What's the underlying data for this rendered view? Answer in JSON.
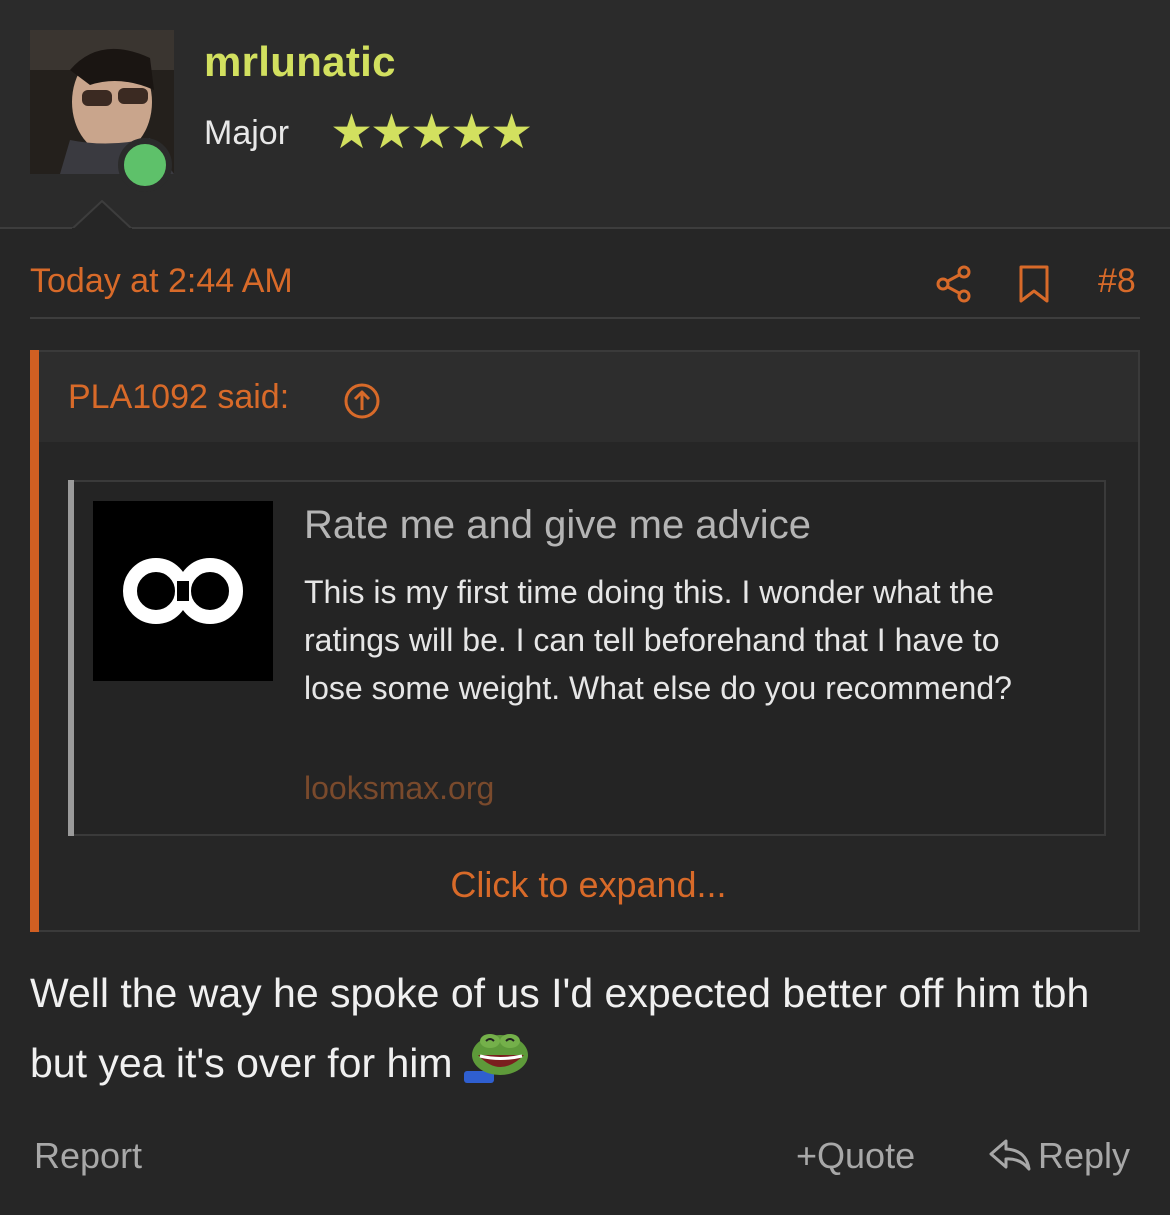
{
  "author": {
    "username": "mrlunatic",
    "rank": "Major",
    "stars": "★★★★★",
    "online": true
  },
  "post": {
    "timestamp": "Today at 2:44 AM",
    "number": "#8"
  },
  "quote": {
    "author_label": "PLA1092 said:",
    "embed": {
      "title": "Rate me and give me advice",
      "description": "This is my first time doing this. I wonder what the ratings will be. I can tell beforehand that I have to lose some weight. What else do you recommend?",
      "url": "looksmax.org"
    },
    "expand_label": "Click to expand..."
  },
  "message": {
    "text": "Well the way he spoke of us I'd expected better off him tbh but yea it's over for him"
  },
  "actions": {
    "report": "Report",
    "quote": "Quote",
    "quote_prefix": "+",
    "reply": "Reply"
  },
  "colors": {
    "accent": "#d86a29",
    "username": "#d2e05f",
    "online": "#5ec16a"
  }
}
